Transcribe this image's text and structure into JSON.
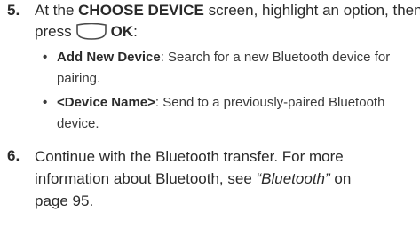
{
  "steps": [
    {
      "number": "5.",
      "pre": "At the ",
      "screen_name": "CHOOSE DEVICE",
      "mid": " screen, highlight an option, then",
      "press": "press",
      "key_label": "OK",
      "after_key": ":",
      "bullets": [
        {
          "title": "Add New Device",
          "text": ": Search for a new Bluetooth device for",
          "text2": "pairing."
        },
        {
          "title": "<Device Name>",
          "text": ": Send to a previously-paired Bluetooth",
          "text2": "device."
        }
      ]
    },
    {
      "number": "6.",
      "line1": "Continue with the Bluetooth transfer. For more",
      "line2_pre": "information about Bluetooth, see ",
      "ref": "“Bluetooth”",
      "line2_post": " on",
      "line3": "page 95."
    }
  ]
}
